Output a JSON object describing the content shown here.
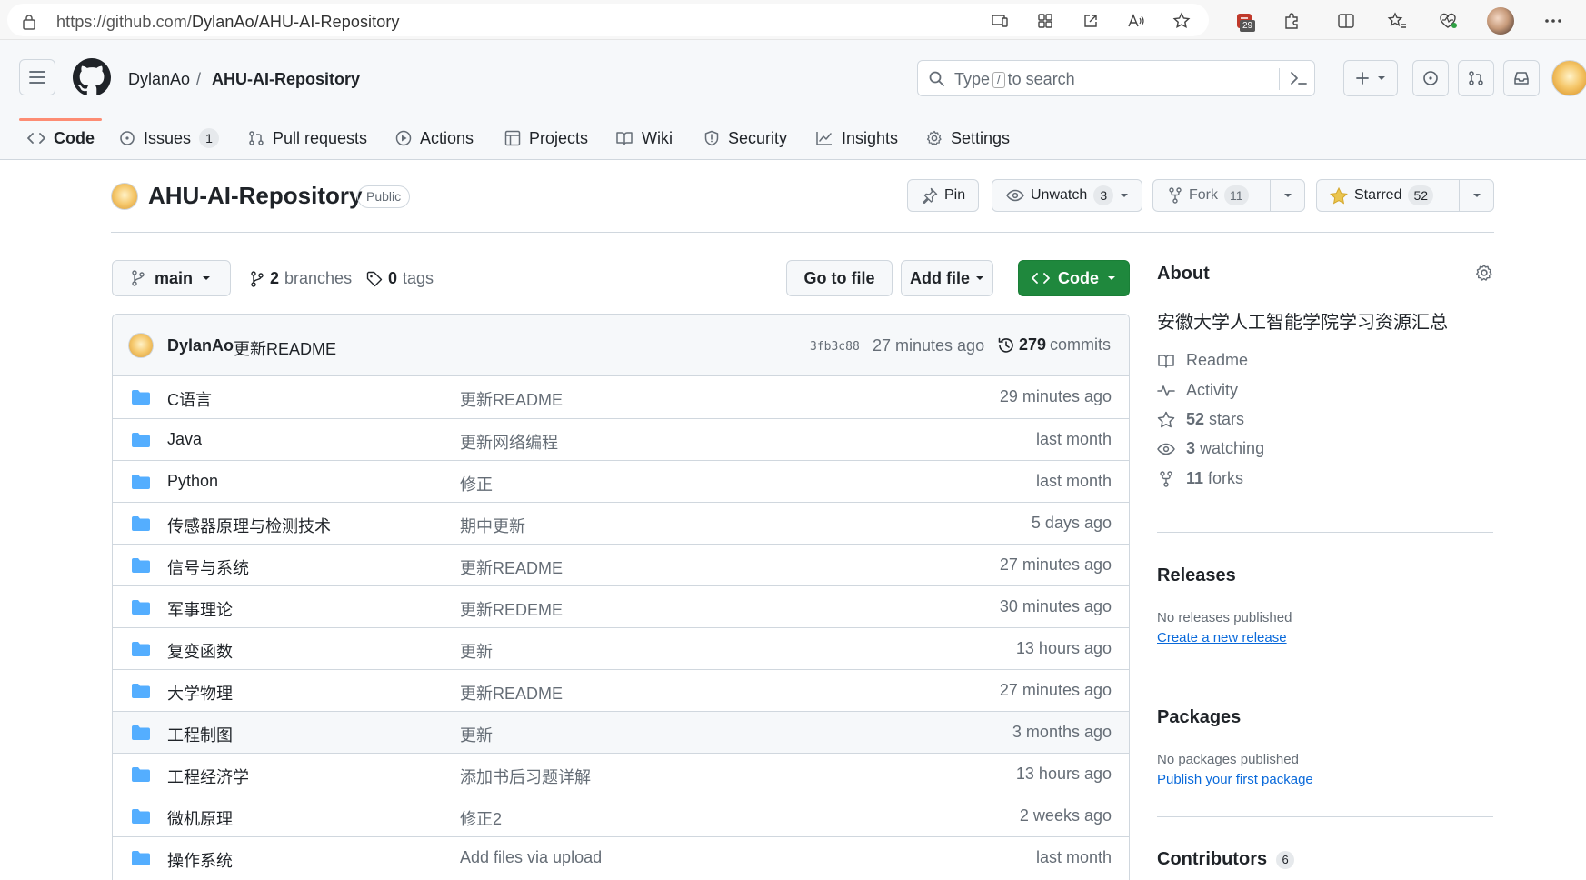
{
  "browser": {
    "url_host": "https://github.com/",
    "url_path": "DylanAo/AHU-AI-Repository",
    "extension_badge": "29"
  },
  "header": {
    "owner": "DylanAo",
    "separator": "/",
    "repo": "AHU-AI-Repository",
    "search_prefix": "Type",
    "search_key": "/",
    "search_suffix": "to search"
  },
  "tabs": [
    {
      "label": "Code",
      "icon": "code-icon",
      "selected": true
    },
    {
      "label": "Issues",
      "icon": "issue-icon",
      "count": "1"
    },
    {
      "label": "Pull requests",
      "icon": "pull-request-icon"
    },
    {
      "label": "Actions",
      "icon": "play-icon"
    },
    {
      "label": "Projects",
      "icon": "table-icon"
    },
    {
      "label": "Wiki",
      "icon": "book-icon"
    },
    {
      "label": "Security",
      "icon": "shield-icon"
    },
    {
      "label": "Insights",
      "icon": "graph-icon"
    },
    {
      "label": "Settings",
      "icon": "gear-icon"
    }
  ],
  "repo_title": {
    "name": "AHU-AI-Repository",
    "visibility": "Public",
    "pin_label": "Pin",
    "watch_label": "Unwatch",
    "watch_count": "3",
    "fork_label": "Fork",
    "fork_count": "11",
    "star_label": "Starred",
    "star_count": "52"
  },
  "branch_row": {
    "branch": "main",
    "branches_count": "2",
    "branches_label": "branches",
    "tags_count": "0",
    "tags_label": "tags",
    "go_to_file": "Go to file",
    "add_file": "Add file",
    "code": "Code"
  },
  "latest_commit": {
    "author": "DylanAo",
    "message": "更新README",
    "sha": "3fb3c88",
    "time": "27 minutes ago",
    "commits_count": "279",
    "commits_label": "commits"
  },
  "files": [
    {
      "name": "C语言",
      "message": "更新README",
      "time": "29 minutes ago"
    },
    {
      "name": "Java",
      "message": "更新网络编程",
      "time": "last month"
    },
    {
      "name": "Python",
      "message": "修正",
      "time": "last month"
    },
    {
      "name": "传感器原理与检测技术",
      "message": "期中更新",
      "time": "5 days ago"
    },
    {
      "name": "信号与系统",
      "message": "更新README",
      "time": "27 minutes ago"
    },
    {
      "name": "军事理论",
      "message": "更新REDEME",
      "time": "30 minutes ago"
    },
    {
      "name": "复变函数",
      "message": "更新",
      "time": "13 hours ago"
    },
    {
      "name": "大学物理",
      "message": "更新README",
      "time": "27 minutes ago"
    },
    {
      "name": "工程制图",
      "message": "更新",
      "time": "3 months ago"
    },
    {
      "name": "工程经济学",
      "message": "添加书后习题详解",
      "time": "13 hours ago"
    },
    {
      "name": "微机原理",
      "message": "修正2",
      "time": "2 weeks ago"
    },
    {
      "name": "操作系统",
      "message": "Add files via upload",
      "time": "last month"
    }
  ],
  "about": {
    "title": "About",
    "description": "安徽大学人工智能学院学习资源汇总",
    "readme": "Readme",
    "activity": "Activity",
    "stars_count": "52",
    "stars_label": "stars",
    "watching_count": "3",
    "watching_label": "watching",
    "forks_count": "11",
    "forks_label": "forks"
  },
  "releases": {
    "title": "Releases",
    "empty": "No releases published",
    "link": "Create a new release"
  },
  "packages": {
    "title": "Packages",
    "empty": "No packages published",
    "link": "Publish your first package"
  },
  "contributors": {
    "title": "Contributors",
    "count": "6"
  },
  "colors": {
    "accent_green": "#1f883d",
    "link_blue": "#0969da",
    "folder_blue": "#54aeff",
    "tab_underline": "#fd8c73",
    "star_yellow": "#eac54f"
  }
}
